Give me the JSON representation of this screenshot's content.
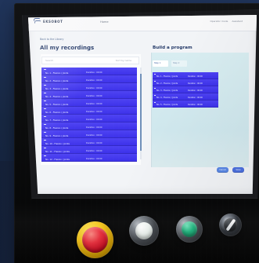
{
  "app": {
    "brand_text": "EKSOBOT",
    "top_center": "Home",
    "top_actions": [
      "Operator mode",
      "Assistant"
    ]
  },
  "recordings_view": {
    "back_label": "Back to the Library",
    "title": "All my recordings",
    "search_placeholder": "Search",
    "sort_label": "Sort by name",
    "items": [
      {
        "title": "No. 1 - Flexion / Joints",
        "meta": "Duration : 00:00"
      },
      {
        "title": "No. 2 - Flexion / Joints",
        "meta": "Duration : 00:00"
      },
      {
        "title": "No. 3 - Flexion / Joints",
        "meta": "Duration : 00:00"
      },
      {
        "title": "No. 4 - Flexion / Joints",
        "meta": "Duration : 00:00"
      },
      {
        "title": "No. 5 - Flexion / Joints",
        "meta": "Duration : 00:00"
      },
      {
        "title": "No. 6 - Flexion / Joints",
        "meta": "Duration : 00:00"
      },
      {
        "title": "No. 7 - Flexion / Joints",
        "meta": "Duration : 00:00"
      },
      {
        "title": "No. 8 - Flexion / Joints",
        "meta": "Duration : 00:00"
      },
      {
        "title": "No. 9 - Flexion / Joints",
        "meta": "Duration : 00:00"
      },
      {
        "title": "No. 10 - Flexion / Joints",
        "meta": "Duration : 00:00"
      },
      {
        "title": "No. 11 - Flexion / Joints",
        "meta": "Duration : 00:00"
      },
      {
        "title": "No. 12 - Flexion / Joints",
        "meta": "Duration : 00:00"
      }
    ]
  },
  "program_builder": {
    "title": "Build a program",
    "tabs": [
      "Step 1",
      "Step 2"
    ],
    "items": [
      {
        "title": "No. 1 - Flexion / Joints",
        "meta": "Duration : 00:00"
      },
      {
        "title": "No. 2 - Flexion / Joints",
        "meta": "Duration : 00:00"
      },
      {
        "title": "No. 3 - Flexion / Joints",
        "meta": "Duration : 00:00"
      },
      {
        "title": "No. 4 - Flexion / Joints",
        "meta": "Duration : 00:00"
      },
      {
        "title": "No. 5 - Flexion / Joints",
        "meta": "Duration : 00:00"
      }
    ],
    "actions": [
      "Cancel",
      "Save"
    ]
  },
  "colors": {
    "screen_bg": "#f2f4f7",
    "recording_blue": "#4336ef",
    "panel_cyan": "#d3eaef",
    "machine_black": "#0b0b0c",
    "estop_red": "#db1022",
    "estop_yellow": "#f1c518",
    "green_button": "#20b47d"
  },
  "hardware": {
    "buttons": [
      {
        "name": "emergency-stop-button",
        "icon": "emergency-stop-icon"
      },
      {
        "name": "white-push-button",
        "icon": "white-button-icon"
      },
      {
        "name": "green-push-button",
        "icon": "green-button-icon"
      },
      {
        "name": "selector-switch",
        "icon": "selector-switch-icon"
      }
    ]
  }
}
